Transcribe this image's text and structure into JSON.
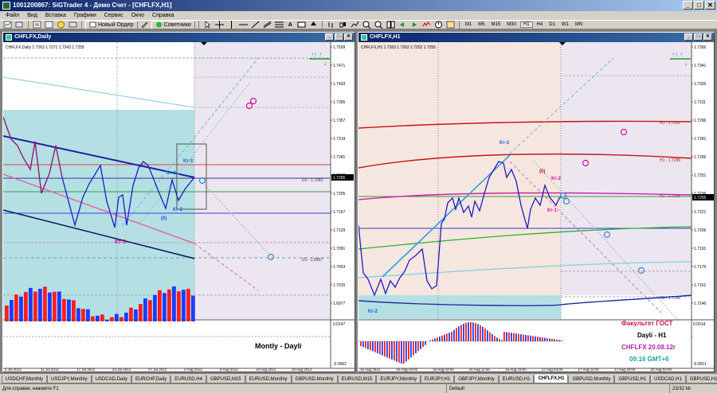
{
  "app": {
    "title": "1001200867: SiGTrader 4 - Демо Счет - [CHFLFX,H1]",
    "window_buttons": [
      "_",
      "□",
      "✕"
    ]
  },
  "menu": [
    "Файл",
    "Вид",
    "Вставка",
    "Графики",
    "Сервис",
    "Окно",
    "Справка"
  ],
  "toolbar": {
    "new_order": "Новый Ордер",
    "advisors": "Советники",
    "timeframes": [
      "M1",
      "M5",
      "M15",
      "M30",
      "H1",
      "H4",
      "D1",
      "W1",
      "MN"
    ],
    "active_timeframe": "H1"
  },
  "left_chart": {
    "window_title": "CHFLFX,Daily",
    "info": "CHFLFX,Daily  1.7263 1.7271 1.7243 1.7255",
    "price_labels": [
      "1.7509",
      "1.7471",
      "1.7433",
      "1.7395",
      "1.7357",
      "1.7319",
      "1.7281",
      "1.7243",
      "1.7205",
      "1.7167",
      "1.7129",
      "1.7091",
      "1.7053",
      "1.7015",
      "1.6977"
    ],
    "current_price": "1.7255",
    "date_labels": [
      "5 Jul 2012",
      "11 Jul 2012",
      "17 Jul 2012",
      "23 Jul 2012",
      "27 Jul 2012",
      "2 Aug 2012",
      "8 Aug 2012",
      "14 Aug 2012",
      "20 Aug 2012"
    ],
    "wave_labels": [
      "Кт-1",
      "Кт-3",
      "Кт-2",
      "(0)",
      "Кт-3"
    ],
    "level_labels": [
      "D1 - 1.7283",
      "D1 - 1.6967"
    ],
    "osc_labels": [
      "0.0147",
      "-0.0062"
    ],
    "caption": "Montly - Dayli"
  },
  "right_chart": {
    "window_title": "CHFLFX,H1",
    "info": "CHFLFX,H1  1.7263 1.7263 1.7252 1.7255",
    "price_labels": [
      "1.7356",
      "1.7341",
      "1.7326",
      "1.7311",
      "1.7296",
      "1.7281",
      "1.7266",
      "1.7251",
      "1.7236",
      "1.7221",
      "1.7206",
      "1.7191",
      "1.7176",
      "1.7161",
      "1.7146"
    ],
    "current_price": "1.7255",
    "date_labels": [
      "15 Aug 2012",
      "15 Aug 19:00",
      "16 Aug 03:00",
      "16 Aug 11:00",
      "16 Aug 19:00",
      "17 Aug 03:00",
      "17 Aug 11:00",
      "17 Aug 19:00",
      "20 Aug 03:00"
    ],
    "wave_labels": [
      "Кт-3",
      "(0)",
      "Кт-2",
      "Кт-1",
      "Кт-2"
    ],
    "level_labels": [
      "H1 - 1.7321",
      "H1 - 1.7289",
      "H1 - 1.7255",
      "H1 - 1.7156"
    ],
    "osc_labels": [
      "0.0014",
      "-0.0011"
    ],
    "caption_lines": [
      "Факультет ГОСТ",
      "Dayli - H1",
      "CHFLFX 20.08.12г",
      "09:16 GMT+6"
    ]
  },
  "tabs": [
    "USDCHF,Monthly",
    "USDJPY,Monthly",
    "USDCAD,Daily",
    "EURCHF,Daily",
    "EURUSD,H4",
    "GBPUSD,M15",
    "EURUSD,Monthly",
    "GBPUSD,Monthly",
    "EURUSD,M15",
    "EURJPY,Monthly",
    "EURJPY,H1",
    "GBPJPY,Monthly",
    "EURUSD,H1",
    "CHFLFX,H1",
    "GBPUSD,Monthly",
    "GBPUSD,H1",
    "USDCAD,H1",
    "GBPUSD,H1"
  ],
  "active_tab": "CHFLFX,H1",
  "status": {
    "help": "Для справки, нажмите F1",
    "profile": "Default",
    "traffic": "23/32 kb"
  },
  "colors": {
    "title_start": "#0a246a",
    "title_end": "#a6caf0",
    "teal_zone": "#b4e0e4",
    "lavender_zone": "#ebe6f0",
    "salmon_zone": "#f6e6e0",
    "price_line": "#1c1cc8",
    "bull_bar": "#ff1e1e",
    "bear_bar": "#1e3cff"
  }
}
